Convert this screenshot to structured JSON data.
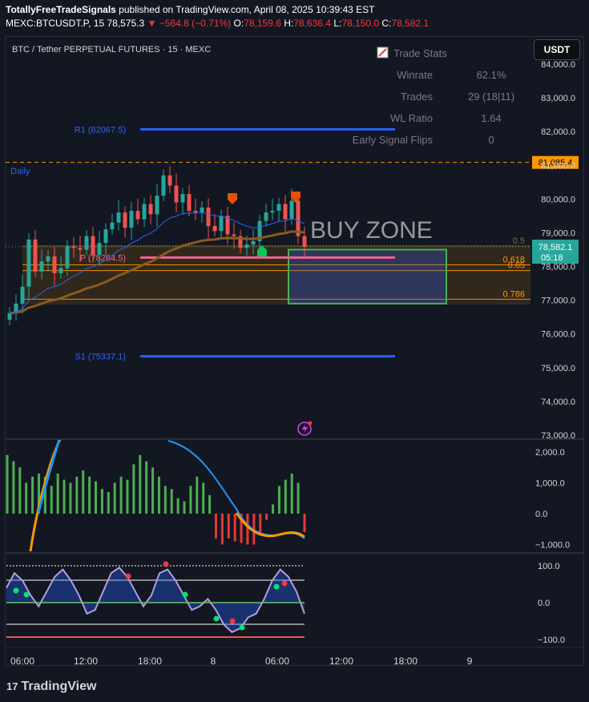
{
  "header": {
    "publisher": "TotallyFreeTradeSignals",
    "published_text": "published on TradingView.com, April 08, 2025 10:39:43 EST",
    "symbol_line": "MEXC:BTCUSDT.P, 15",
    "last": "78,575.3",
    "change": "▼ −564.8 (−0.71%)",
    "o_label": "O:",
    "o": "78,159.6",
    "h_label": "H:",
    "h": "78,636.4",
    "l_label": "L:",
    "l": "78,150.0",
    "c_label": "C:",
    "c": "78,582.1"
  },
  "toolbar": {
    "currency_button": "USDT"
  },
  "footer": {
    "brand": "TradingView",
    "logo_glyph": "17"
  },
  "colors": {
    "bg": "#131722",
    "up": "#26a69a",
    "down": "#ef5350",
    "pivot": "#2962ff",
    "fib": "#ff9800",
    "ema": "#8b5a1e",
    "green_hist": "#4caf50",
    "red_hist": "#e53935"
  },
  "chart_data": {
    "type": "candlestick",
    "title": "BTC / Tether PERPETUAL FUTURES · 15 · MEXC",
    "timeframe_tag": "Daily",
    "y_axis_ticks": [
      "84,000.0",
      "83,000.0",
      "82,000.0",
      "81,000.0",
      "80,000.0",
      "79,000.0",
      "78,000.0",
      "77,000.0",
      "76,000.0",
      "75,000.0",
      "74,000.0",
      "73,000.0"
    ],
    "y_range": [
      72950,
      84450
    ],
    "x_axis_ticks": [
      "06:00",
      "12:00",
      "18:00",
      "8",
      "06:00",
      "12:00",
      "18:00",
      "9"
    ],
    "last_price_label": "78,582.1",
    "countdown": "05:18",
    "dashed_level_label": "81,085.4",
    "dashed_level": 81085.4,
    "last_price": 78582.1,
    "pivots": [
      {
        "label": "R1 (82067.5)",
        "value": 82067.5
      },
      {
        "label": "P (78264.5)",
        "value": 78264.5
      },
      {
        "label": "S1 (75337.1)",
        "value": 75337.1
      }
    ],
    "fib_levels": [
      {
        "label": "0.5",
        "value": 78610
      },
      {
        "label": "0.618",
        "value": 78050
      },
      {
        "label": "0.65",
        "value": 77880
      },
      {
        "label": "0.786",
        "value": 77030
      }
    ],
    "buy_zone_label": "BUY ZONE",
    "buy_zone": {
      "top": 78500,
      "bottom": 76900
    },
    "trade_stats": {
      "title": "Trade Stats",
      "rows": [
        {
          "label": "Winrate",
          "value": "62.1%"
        },
        {
          "label": "Trades",
          "value": "29 (18|11)"
        },
        {
          "label": "WL Ratio",
          "value": "1.64"
        },
        {
          "label": "Early Signal Flips",
          "value": "0"
        }
      ]
    },
    "price_series": [
      76620,
      76900,
      77400,
      78800,
      77850,
      78150,
      78300,
      77800,
      77950,
      78600,
      78550,
      78500,
      78900,
      78350,
      78700,
      79100,
      79300,
      79600,
      79150,
      79650,
      79400,
      79850,
      79550,
      80100,
      80700,
      80400,
      79900,
      80150,
      79650,
      79600,
      79750,
      79200,
      79050,
      79500,
      78950,
      78900,
      78550,
      78650,
      78750,
      79350,
      79600,
      79650,
      79850,
      79400,
      79950,
      78900,
      78580
    ],
    "macd_axis_ticks": [
      "2,000.0",
      "1,000.0",
      "0.0",
      "−1,000.0"
    ],
    "macd_hist": [
      1900,
      1700,
      1500,
      1000,
      1200,
      1300,
      1200,
      900,
      1300,
      1100,
      1000,
      1200,
      1400,
      1200,
      1050,
      800,
      700,
      1000,
      1200,
      1100,
      1600,
      1900,
      1700,
      1500,
      1200,
      900,
      800,
      500,
      400,
      900,
      1200,
      1000,
      600,
      -800,
      -1000,
      -800,
      -900,
      -950,
      -1000,
      -1000,
      -700,
      -200,
      300,
      900,
      1100,
      1300,
      1000,
      -600
    ],
    "osc_axis_ticks": [
      "100.0",
      "0.0",
      "−100.0"
    ],
    "osc_series": [
      40,
      80,
      60,
      20,
      -10,
      30,
      70,
      90,
      60,
      20,
      -30,
      -20,
      30,
      80,
      95,
      70,
      30,
      -10,
      20,
      80,
      90,
      60,
      20,
      -20,
      -10,
      10,
      -20,
      -60,
      -80,
      -70,
      -40,
      -30,
      10,
      60,
      90,
      70,
      30,
      -30
    ]
  }
}
